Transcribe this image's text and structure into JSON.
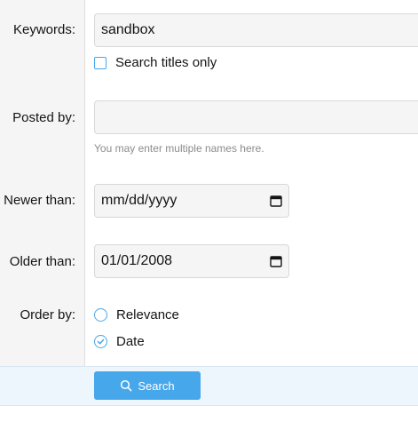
{
  "form": {
    "keywords": {
      "label": "Keywords:",
      "value": "sandbox"
    },
    "search_titles_only": {
      "label": "Search titles only",
      "checked": false
    },
    "posted_by": {
      "label": "Posted by:",
      "value": "",
      "hint": "You may enter multiple names here."
    },
    "newer_than": {
      "label": "Newer than:",
      "value": "mm/dd/yyyy"
    },
    "older_than": {
      "label": "Older than:",
      "value": "01/01/2008"
    },
    "order_by": {
      "label": "Order by:",
      "options": [
        {
          "label": "Relevance",
          "selected": false
        },
        {
          "label": "Date",
          "selected": true
        }
      ]
    }
  },
  "footer": {
    "search_button": "Search"
  },
  "colors": {
    "accent": "#47a7eb",
    "footer_bg": "#edf6fd",
    "label_bg": "#f5f5f5"
  }
}
